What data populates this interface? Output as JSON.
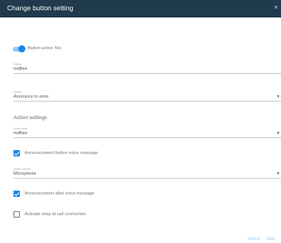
{
  "dialog": {
    "title": "Change button setting",
    "close_glyph": "×"
  },
  "toggle": {
    "label": "Button active Yes",
    "state": "on",
    "accent": "#1e88e5"
  },
  "name_field": {
    "label": "Name",
    "value": "mdfiles"
  },
  "select_field": {
    "label": "Select",
    "value": "Announce to zone"
  },
  "action_settings": {
    "heading": "Action settings",
    "zone_field": {
      "label": "Zone/area",
      "value": "mdfiles"
    },
    "announce_before": {
      "label": "Announcement before voice message",
      "checked": true
    },
    "audio_source": {
      "label": "audio source",
      "value": "Microphone"
    },
    "announce_after": {
      "label": "Announcement after voice message",
      "checked": true
    },
    "relay": {
      "label": "Activate relay at call connection",
      "checked": false
    }
  },
  "icons": {
    "dropdown": "chevron-down-icon",
    "close": "close-icon",
    "check": "check-icon"
  },
  "footer": {
    "cancel_label": "Cancel",
    "save_label": "Save"
  }
}
